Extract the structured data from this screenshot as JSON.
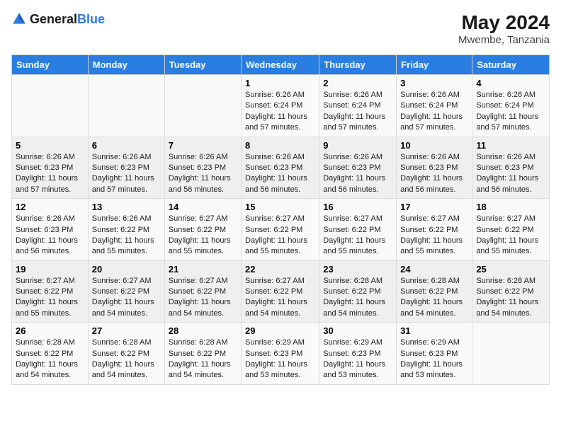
{
  "header": {
    "logo_general": "General",
    "logo_blue": "Blue",
    "month_title": "May 2024",
    "subtitle": "Mwembe, Tanzania"
  },
  "weekdays": [
    "Sunday",
    "Monday",
    "Tuesday",
    "Wednesday",
    "Thursday",
    "Friday",
    "Saturday"
  ],
  "weeks": [
    [
      {
        "day": "",
        "info": ""
      },
      {
        "day": "",
        "info": ""
      },
      {
        "day": "",
        "info": ""
      },
      {
        "day": "1",
        "info": "Sunrise: 6:26 AM\nSunset: 6:24 PM\nDaylight: 11 hours and 57 minutes."
      },
      {
        "day": "2",
        "info": "Sunrise: 6:26 AM\nSunset: 6:24 PM\nDaylight: 11 hours and 57 minutes."
      },
      {
        "day": "3",
        "info": "Sunrise: 6:26 AM\nSunset: 6:24 PM\nDaylight: 11 hours and 57 minutes."
      },
      {
        "day": "4",
        "info": "Sunrise: 6:26 AM\nSunset: 6:24 PM\nDaylight: 11 hours and 57 minutes."
      }
    ],
    [
      {
        "day": "5",
        "info": "Sunrise: 6:26 AM\nSunset: 6:23 PM\nDaylight: 11 hours and 57 minutes."
      },
      {
        "day": "6",
        "info": "Sunrise: 6:26 AM\nSunset: 6:23 PM\nDaylight: 11 hours and 57 minutes."
      },
      {
        "day": "7",
        "info": "Sunrise: 6:26 AM\nSunset: 6:23 PM\nDaylight: 11 hours and 56 minutes."
      },
      {
        "day": "8",
        "info": "Sunrise: 6:26 AM\nSunset: 6:23 PM\nDaylight: 11 hours and 56 minutes."
      },
      {
        "day": "9",
        "info": "Sunrise: 6:26 AM\nSunset: 6:23 PM\nDaylight: 11 hours and 56 minutes."
      },
      {
        "day": "10",
        "info": "Sunrise: 6:26 AM\nSunset: 6:23 PM\nDaylight: 11 hours and 56 minutes."
      },
      {
        "day": "11",
        "info": "Sunrise: 6:26 AM\nSunset: 6:23 PM\nDaylight: 11 hours and 56 minutes."
      }
    ],
    [
      {
        "day": "12",
        "info": "Sunrise: 6:26 AM\nSunset: 6:23 PM\nDaylight: 11 hours and 56 minutes."
      },
      {
        "day": "13",
        "info": "Sunrise: 6:26 AM\nSunset: 6:22 PM\nDaylight: 11 hours and 55 minutes."
      },
      {
        "day": "14",
        "info": "Sunrise: 6:27 AM\nSunset: 6:22 PM\nDaylight: 11 hours and 55 minutes."
      },
      {
        "day": "15",
        "info": "Sunrise: 6:27 AM\nSunset: 6:22 PM\nDaylight: 11 hours and 55 minutes."
      },
      {
        "day": "16",
        "info": "Sunrise: 6:27 AM\nSunset: 6:22 PM\nDaylight: 11 hours and 55 minutes."
      },
      {
        "day": "17",
        "info": "Sunrise: 6:27 AM\nSunset: 6:22 PM\nDaylight: 11 hours and 55 minutes."
      },
      {
        "day": "18",
        "info": "Sunrise: 6:27 AM\nSunset: 6:22 PM\nDaylight: 11 hours and 55 minutes."
      }
    ],
    [
      {
        "day": "19",
        "info": "Sunrise: 6:27 AM\nSunset: 6:22 PM\nDaylight: 11 hours and 55 minutes."
      },
      {
        "day": "20",
        "info": "Sunrise: 6:27 AM\nSunset: 6:22 PM\nDaylight: 11 hours and 54 minutes."
      },
      {
        "day": "21",
        "info": "Sunrise: 6:27 AM\nSunset: 6:22 PM\nDaylight: 11 hours and 54 minutes."
      },
      {
        "day": "22",
        "info": "Sunrise: 6:27 AM\nSunset: 6:22 PM\nDaylight: 11 hours and 54 minutes."
      },
      {
        "day": "23",
        "info": "Sunrise: 6:28 AM\nSunset: 6:22 PM\nDaylight: 11 hours and 54 minutes."
      },
      {
        "day": "24",
        "info": "Sunrise: 6:28 AM\nSunset: 6:22 PM\nDaylight: 11 hours and 54 minutes."
      },
      {
        "day": "25",
        "info": "Sunrise: 6:28 AM\nSunset: 6:22 PM\nDaylight: 11 hours and 54 minutes."
      }
    ],
    [
      {
        "day": "26",
        "info": "Sunrise: 6:28 AM\nSunset: 6:22 PM\nDaylight: 11 hours and 54 minutes."
      },
      {
        "day": "27",
        "info": "Sunrise: 6:28 AM\nSunset: 6:22 PM\nDaylight: 11 hours and 54 minutes."
      },
      {
        "day": "28",
        "info": "Sunrise: 6:28 AM\nSunset: 6:22 PM\nDaylight: 11 hours and 54 minutes."
      },
      {
        "day": "29",
        "info": "Sunrise: 6:29 AM\nSunset: 6:23 PM\nDaylight: 11 hours and 53 minutes."
      },
      {
        "day": "30",
        "info": "Sunrise: 6:29 AM\nSunset: 6:23 PM\nDaylight: 11 hours and 53 minutes."
      },
      {
        "day": "31",
        "info": "Sunrise: 6:29 AM\nSunset: 6:23 PM\nDaylight: 11 hours and 53 minutes."
      },
      {
        "day": "",
        "info": ""
      }
    ]
  ]
}
